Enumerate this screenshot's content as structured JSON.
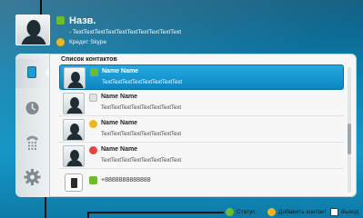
{
  "header": {
    "name": "Назв.",
    "mood": "- TextTextTextTextTextTextTextTextTextText",
    "credit": "Кредит Skype"
  },
  "nav": {
    "items": [
      {
        "icon": "contacts-icon",
        "active": true
      },
      {
        "icon": "clock-icon",
        "active": false
      },
      {
        "icon": "dialpad-icon",
        "active": false
      },
      {
        "icon": "gear-icon",
        "active": false
      }
    ]
  },
  "contacts": {
    "title": "Список контактов",
    "items": [
      {
        "name": "Name Name",
        "mood": "TextTextTextTextTextTextTextText",
        "status": "online",
        "selected": true
      },
      {
        "name": "Name Name",
        "mood": "TextTextTextTextTextTextTextText",
        "status": "offline",
        "selected": false
      },
      {
        "name": "Name Name",
        "mood": "TextTextTextTextTextTextTextText",
        "status": "away",
        "selected": false
      },
      {
        "name": "Name Name",
        "mood": "TextTextTextTextTextTextTextText",
        "status": "do-not-disturb",
        "selected": false
      }
    ],
    "phone": {
      "number": "+8888888888888",
      "status": "online"
    }
  },
  "footer": {
    "status_label": "Статус",
    "add_contact_label": "Добавить контакт",
    "exit_label": "Выход"
  },
  "colors": {
    "online": "#6dbb2f",
    "away": "#f1b51c",
    "dnd": "#e5453d",
    "selection": "#1b9bd6"
  }
}
